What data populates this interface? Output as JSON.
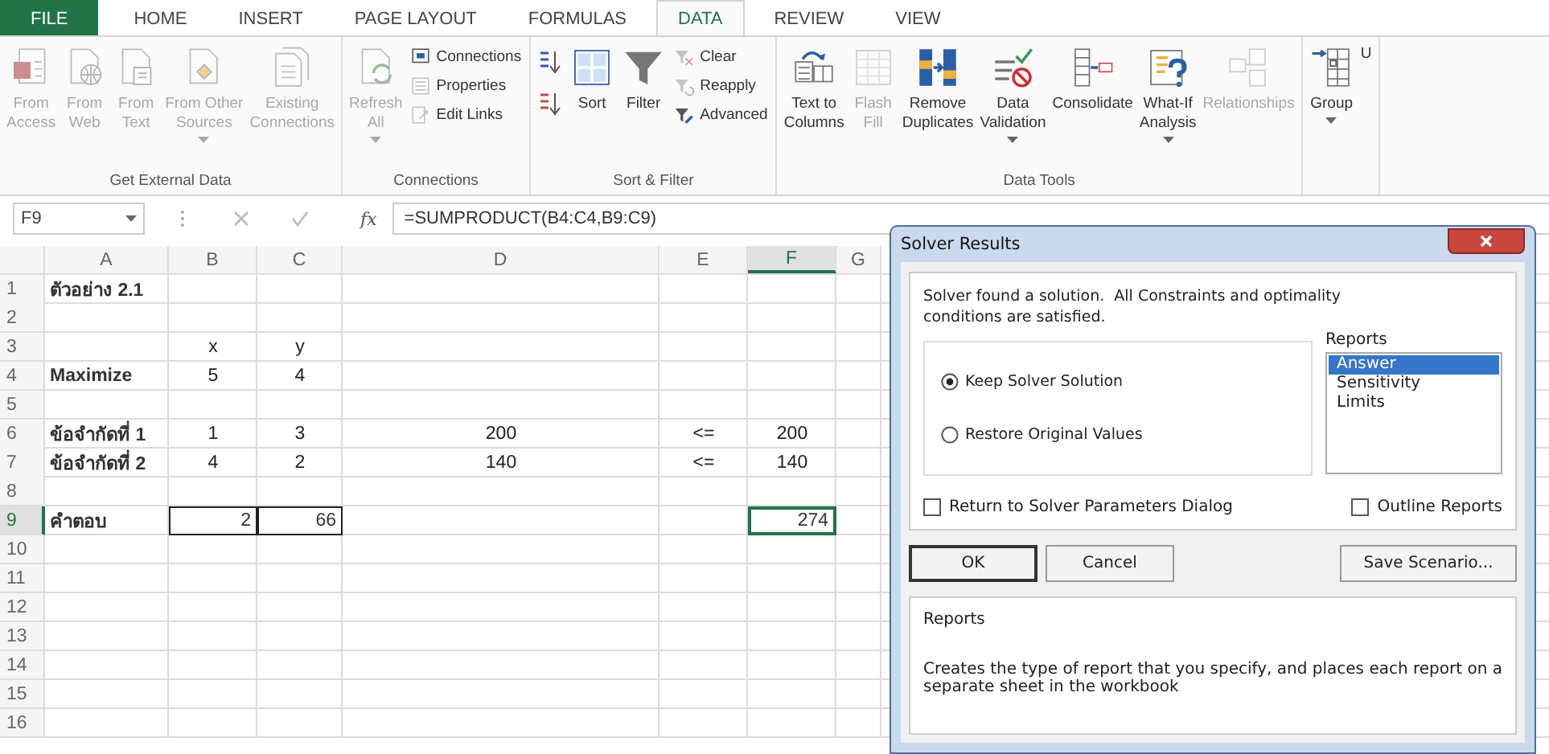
{
  "tabs": [
    {
      "label": "FILE",
      "kind": "file",
      "selected": false
    },
    {
      "label": "HOME",
      "kind": "tab",
      "selected": false
    },
    {
      "label": "INSERT",
      "kind": "tab",
      "selected": false
    },
    {
      "label": "PAGE LAYOUT",
      "kind": "tab",
      "selected": false
    },
    {
      "label": "FORMULAS",
      "kind": "tab",
      "selected": false
    },
    {
      "label": "DATA",
      "kind": "tab",
      "selected": true
    },
    {
      "label": "REVIEW",
      "kind": "tab",
      "selected": false
    },
    {
      "label": "VIEW",
      "kind": "tab",
      "selected": false
    }
  ],
  "ribbon": {
    "groups": [
      {
        "label": "Get External Data",
        "items": [
          {
            "kind": "large",
            "lines": [
              "From",
              "Access"
            ],
            "disabled": true,
            "dropdown": false
          },
          {
            "kind": "large",
            "lines": [
              "From",
              "Web"
            ],
            "disabled": true,
            "dropdown": false
          },
          {
            "kind": "large",
            "lines": [
              "From",
              "Text"
            ],
            "disabled": true,
            "dropdown": false
          },
          {
            "kind": "large",
            "lines": [
              "From Other",
              "Sources"
            ],
            "disabled": true,
            "dropdown": true
          },
          {
            "kind": "large",
            "lines": [
              "Existing",
              "Connections"
            ],
            "disabled": true,
            "dropdown": false
          }
        ]
      },
      {
        "label": "Connections",
        "items": [
          {
            "kind": "large",
            "lines": [
              "Refresh",
              "All"
            ],
            "disabled": true,
            "dropdown": true
          },
          {
            "kind": "stack",
            "items": [
              {
                "label": "Connections",
                "disabled": false
              },
              {
                "label": "Properties",
                "disabled": true
              },
              {
                "label": "Edit Links",
                "disabled": true
              }
            ]
          }
        ]
      },
      {
        "label": "Sort & Filter",
        "items": [
          {
            "kind": "sortpair"
          },
          {
            "kind": "large",
            "lines": [
              "Sort"
            ],
            "disabled": false,
            "dropdown": false
          },
          {
            "kind": "large",
            "lines": [
              "Filter"
            ],
            "disabled": false,
            "dropdown": false
          },
          {
            "kind": "stack",
            "items": [
              {
                "label": "Clear",
                "disabled": true
              },
              {
                "label": "Reapply",
                "disabled": true
              },
              {
                "label": "Advanced",
                "disabled": false
              }
            ]
          }
        ]
      },
      {
        "label": "Data Tools",
        "items": [
          {
            "kind": "large",
            "lines": [
              "Text to",
              "Columns"
            ],
            "disabled": false,
            "dropdown": false
          },
          {
            "kind": "large",
            "lines": [
              "Flash",
              "Fill"
            ],
            "disabled": true,
            "dropdown": false
          },
          {
            "kind": "large",
            "lines": [
              "Remove",
              "Duplicates"
            ],
            "disabled": false,
            "dropdown": false
          },
          {
            "kind": "large",
            "lines": [
              "Data",
              "Validation"
            ],
            "disabled": false,
            "dropdown": true
          },
          {
            "kind": "large",
            "lines": [
              "Consolidate"
            ],
            "disabled": false,
            "dropdown": false
          },
          {
            "kind": "large",
            "lines": [
              "What-If",
              "Analysis"
            ],
            "disabled": false,
            "dropdown": true
          },
          {
            "kind": "large",
            "lines": [
              "Relationships"
            ],
            "disabled": true,
            "dropdown": false
          }
        ]
      },
      {
        "items": [
          {
            "kind": "large",
            "lines": [
              "Group"
            ],
            "disabled": false,
            "dropdown": true
          },
          {
            "kind": "large",
            "lines": [
              "U"
            ],
            "disabled": false,
            "dropdown": false
          }
        ]
      }
    ]
  },
  "formula_bar": {
    "name_box": "F9",
    "function_label": "fx",
    "formula": "=SUMPRODUCT(B4:C4,B9:C9)"
  },
  "sheet": {
    "columns": [
      {
        "label": "A",
        "selected": false
      },
      {
        "label": "B",
        "selected": false
      },
      {
        "label": "C",
        "selected": false
      },
      {
        "label": "D",
        "selected": false
      },
      {
        "label": "E",
        "selected": false
      },
      {
        "label": "F",
        "selected": true
      },
      {
        "label": "G",
        "selected": false
      }
    ],
    "rows": [
      {
        "label": "1",
        "selected": false,
        "kind": "plain",
        "cells": [
          "ตัวอย่าง 2.1"
        ]
      },
      {
        "label": "2",
        "selected": false,
        "kind": "plain"
      },
      {
        "label": "3",
        "selected": false,
        "kind": "plain",
        "cells": [
          null,
          "x",
          "y"
        ]
      },
      {
        "label": "4",
        "selected": false,
        "kind": "plain",
        "cells": [
          "Maximize",
          "5",
          "4"
        ]
      },
      {
        "label": "5",
        "selected": false,
        "kind": "plain"
      },
      {
        "label": "6",
        "selected": false,
        "kind": "plain",
        "cells": [
          "ข้อจำกัดที่ 1",
          "1",
          "3",
          "200",
          "<=",
          "200"
        ]
      },
      {
        "label": "7",
        "selected": false,
        "kind": "plain",
        "cells": [
          "ข้อจำกัดที่ 2",
          "4",
          "2",
          "140",
          "<=",
          "140"
        ]
      },
      {
        "label": "8",
        "selected": false,
        "kind": "plain"
      },
      {
        "label": "9",
        "selected": true,
        "kind": "result",
        "cells": [
          "คำตอบ",
          "2",
          "66",
          null,
          null,
          "274"
        ]
      },
      {
        "label": "10",
        "selected": false,
        "kind": "plain"
      },
      {
        "label": "11",
        "selected": false,
        "kind": "plain"
      },
      {
        "label": "12",
        "selected": false,
        "kind": "plain"
      },
      {
        "label": "13",
        "selected": false,
        "kind": "plain"
      },
      {
        "label": "14",
        "selected": false,
        "kind": "plain"
      },
      {
        "label": "15",
        "selected": false,
        "kind": "plain"
      },
      {
        "label": "16",
        "selected": false,
        "kind": "plain"
      }
    ]
  },
  "dialog": {
    "title": "Solver Results",
    "message": "Solver found a solution.  All Constraints and optimality conditions are satisfied.",
    "options": [
      {
        "label": "Keep Solver Solution",
        "selected": true
      },
      {
        "label": "Restore Original Values",
        "selected": false
      }
    ],
    "reports_label": "Reports",
    "reports": [
      {
        "label": "Answer",
        "selected": true
      },
      {
        "label": "Sensitivity",
        "selected": false
      },
      {
        "label": "Limits",
        "selected": false
      }
    ],
    "checkboxes": [
      {
        "label": "Return to Solver Parameters Dialog",
        "checked": false
      },
      {
        "label": "Outline Reports",
        "checked": false
      }
    ],
    "buttons": [
      {
        "label": "OK",
        "default": true
      },
      {
        "label": "Cancel",
        "default": false
      },
      {
        "label": "Save Scenario...",
        "default": false
      }
    ],
    "info": {
      "title": "Reports",
      "text": "Creates the type of report that you specify, and places each report on a separate sheet in the workbook"
    }
  }
}
